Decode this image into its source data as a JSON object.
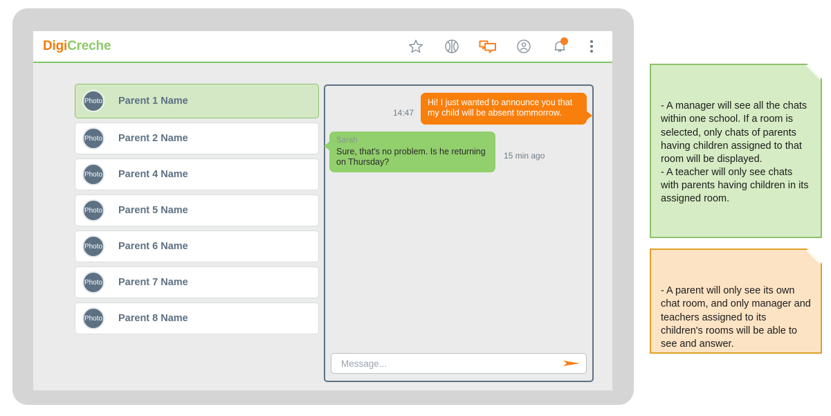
{
  "app": {
    "logo_first": "Digi",
    "logo_second": "Creche",
    "accent_orange": "#f47b0a",
    "accent_green": "#8dc96a",
    "avatar_color": "#5d7183"
  },
  "header": {
    "icons": [
      {
        "name": "star-icon",
        "label": "Favourites"
      },
      {
        "name": "ball-icon",
        "label": "Activities"
      },
      {
        "name": "chat-icon",
        "label": "Chats"
      },
      {
        "name": "profile-icon",
        "label": "Profile"
      },
      {
        "name": "bell-icon",
        "label": "Notifications"
      },
      {
        "name": "kebab-menu-icon",
        "label": "More options"
      }
    ],
    "notification_badge": true
  },
  "parent_list": [
    {
      "avatar_label": "Photo",
      "name": "Parent 1 Name",
      "selected": true
    },
    {
      "avatar_label": "Photo",
      "name": "Parent 2 Name",
      "selected": false
    },
    {
      "avatar_label": "Photo",
      "name": "Parent 4 Name",
      "selected": false
    },
    {
      "avatar_label": "Photo",
      "name": "Parent 5 Name",
      "selected": false
    },
    {
      "avatar_label": "Photo",
      "name": "Parent 6 Name",
      "selected": false
    },
    {
      "avatar_label": "Photo",
      "name": "Parent 7 Name",
      "selected": false
    },
    {
      "avatar_label": "Photo",
      "name": "Parent 8 Name",
      "selected": false
    }
  ],
  "chat": {
    "messages": [
      {
        "direction": "out",
        "sender": "",
        "text": "Hi! I just wanted to announce you that my child will be absent tommorrow.",
        "time": "14:47",
        "color": "orange"
      },
      {
        "direction": "in",
        "sender": "Sarah",
        "text": "Sure, that's no problem. Is he returning on Thursday?",
        "time": "15 min ago",
        "color": "green"
      }
    ],
    "composer": {
      "placeholder": "Message...",
      "value": "",
      "send_icon": "send-paper-plane-icon"
    }
  },
  "notes": [
    {
      "id": "note-roles-manager-teacher",
      "color": "green",
      "text": "- A manager will see all the chats within one school. If a room is selected, only chats of parents having children assigned to that room will be displayed.\n- A teacher will only see chats with parents having children in its assigned room."
    },
    {
      "id": "note-roles-parent",
      "color": "orange",
      "text": "- A parent will only see its own chat room, and only manager and teachers assigned to its children's rooms will be able to see and answer."
    }
  ]
}
